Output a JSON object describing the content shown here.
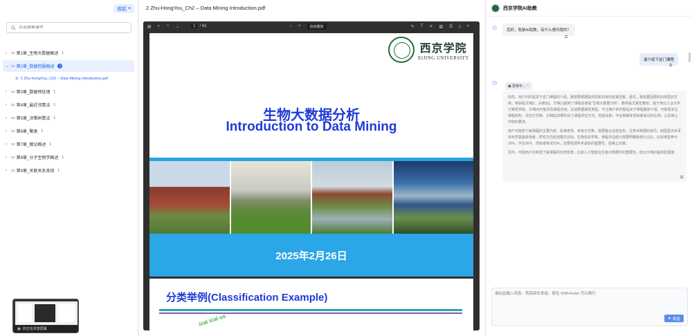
{
  "sidebar": {
    "collapse_label": "收起",
    "search_placeholder": "点击搜索课件",
    "chapters": [
      {
        "label": "第1章_生物大数据概述",
        "count": "1"
      },
      {
        "label": "第2章_数据挖掘概述",
        "count": "1"
      },
      {
        "label": "第3章_数据预处理",
        "count": "1"
      },
      {
        "label": "第4章_最近邻算法",
        "count": "1"
      },
      {
        "label": "第5章_决策树算法",
        "count": "1"
      },
      {
        "label": "第6章_聚类",
        "count": "1"
      },
      {
        "label": "第7章_图论概述",
        "count": "1"
      },
      {
        "label": "第8章_分子生物学概述",
        "count": "1"
      },
      {
        "label": "第9章_关联关系发现",
        "count": "1"
      }
    ],
    "active_file": "2 Zhu-HongYou_Ch2 – Data Mining Introduction.pdf",
    "screen_share_label": "你正在共享屏幕"
  },
  "viewer": {
    "doc_title": "2 Zhu-HongYou_Ch2 – Data Mining Introduction.pdf",
    "current_page": "1",
    "total_pages": "/ 41",
    "auto_label": "自动播放",
    "slide": {
      "logo_cn": "西京学院",
      "logo_en": "XIJING UNIVERSITY",
      "title_cn": "生物大数据分析",
      "title_en": "Introduction to Data Mining",
      "date": "2025年2月26日"
    },
    "slide2": {
      "title": "分类举例(Classification Example)",
      "words": "ical   ical   us"
    }
  },
  "chat": {
    "title": "西京学院AI助教",
    "greeting": "您好，我是AI助教，有什么想问我的？",
    "user_message": "请介绍下这门课程",
    "thinking_label": "思考中...",
    "answer_paragraphs": [
      "好的。用户问的是关于这门课程的介绍。我需要根据提供的知识库内容来回答。首先，我需要回顾知识库里的文档，特别是文档[1、[4]和[5]。文档[1]提到了课程名称是“生物大数据分析”，教师是尤豪宏教授，属于西北工业大学计算机学院。文档[4]可能涉及课程内容，比如数据属性类型、不过用户的问题是关于课程整体介绍，可能更关注课程结构、评估方式等。文档[5]详细列出了课程评估方式，包括出勤、作业和期末项目或考试的比例，以及禁止作弊的要求。",
      "用户可能想了解课程的主要内容、授课老师、考核方式等。需要整合这些信息，注意术数据的来历。如因里杰出青年科学基金获得者、研究方向包括模式识别、生物信息学等。课程评估部分需要明确各部分占比，比如课堂参与20%，作业30%，项目或考试50%，还要强调学术诚信的重要性，如禁止抄袭。",
      "另外，可能用户还希望了解课程的应用背景，比如人工智能在生物大数据中的重要性，结合文档[2]提到的国家"
    ],
    "input_placeholder": "请在此输入消息，然后回车发送，按住 Shift+Enter 可以换行",
    "send_label": "发送"
  }
}
